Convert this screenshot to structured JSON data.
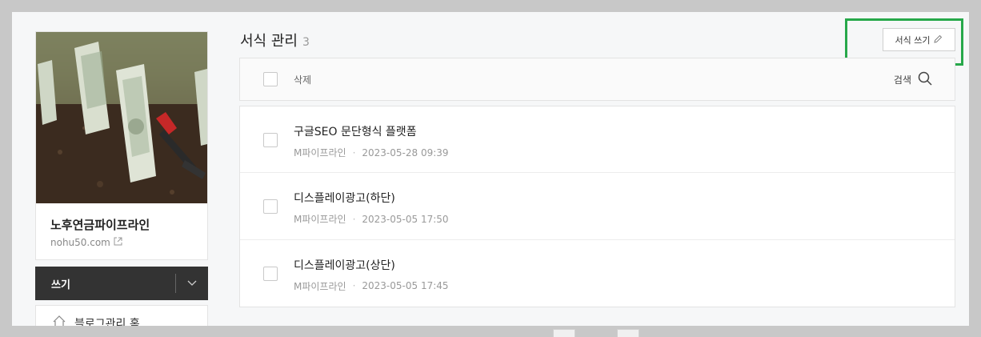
{
  "sidebar": {
    "blog_name": "노후연금파이프라인",
    "blog_url": "nohu50.com",
    "write_label": "쓰기",
    "home_label": "블로그관리 홈"
  },
  "main": {
    "title": "서식 관리",
    "count": "3",
    "write_form_label": "서식 쓰기",
    "toolbar": {
      "delete_label": "삭제",
      "search_label": "검색"
    },
    "rows": [
      {
        "title": "구글SEO 문단형식 플랫폼",
        "author": "M파이프라인",
        "date": "2023-05-28 09:39"
      },
      {
        "title": "디스플레이광고(하단)",
        "author": "M파이프라인",
        "date": "2023-05-05 17:50"
      },
      {
        "title": "디스플레이광고(상단)",
        "author": "M파이프라인",
        "date": "2023-05-05 17:45"
      }
    ]
  },
  "colors": {
    "highlight": "#27a84a",
    "write_bar": "#333333"
  }
}
